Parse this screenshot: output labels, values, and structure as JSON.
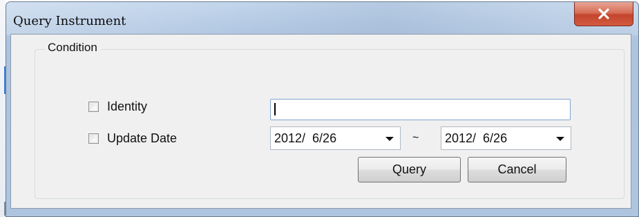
{
  "window": {
    "title": "Query Instrument"
  },
  "icons": {
    "close": "close-icon",
    "dropdown": "chevron-down-icon"
  },
  "colors": {
    "titlebar": "#b7cce5",
    "client_background": "#f0f0f0",
    "close_button": "#c3442c",
    "input_border": "#7fa3cf"
  },
  "condition_group": {
    "legend": "Condition",
    "identity": {
      "label": "Identity",
      "checked": false,
      "value": ""
    },
    "update_date": {
      "label": "Update Date",
      "checked": false,
      "from": "2012/  6/26",
      "separator": "~",
      "to": "2012/  6/26"
    }
  },
  "buttons": {
    "query": "Query",
    "cancel": "Cancel"
  }
}
